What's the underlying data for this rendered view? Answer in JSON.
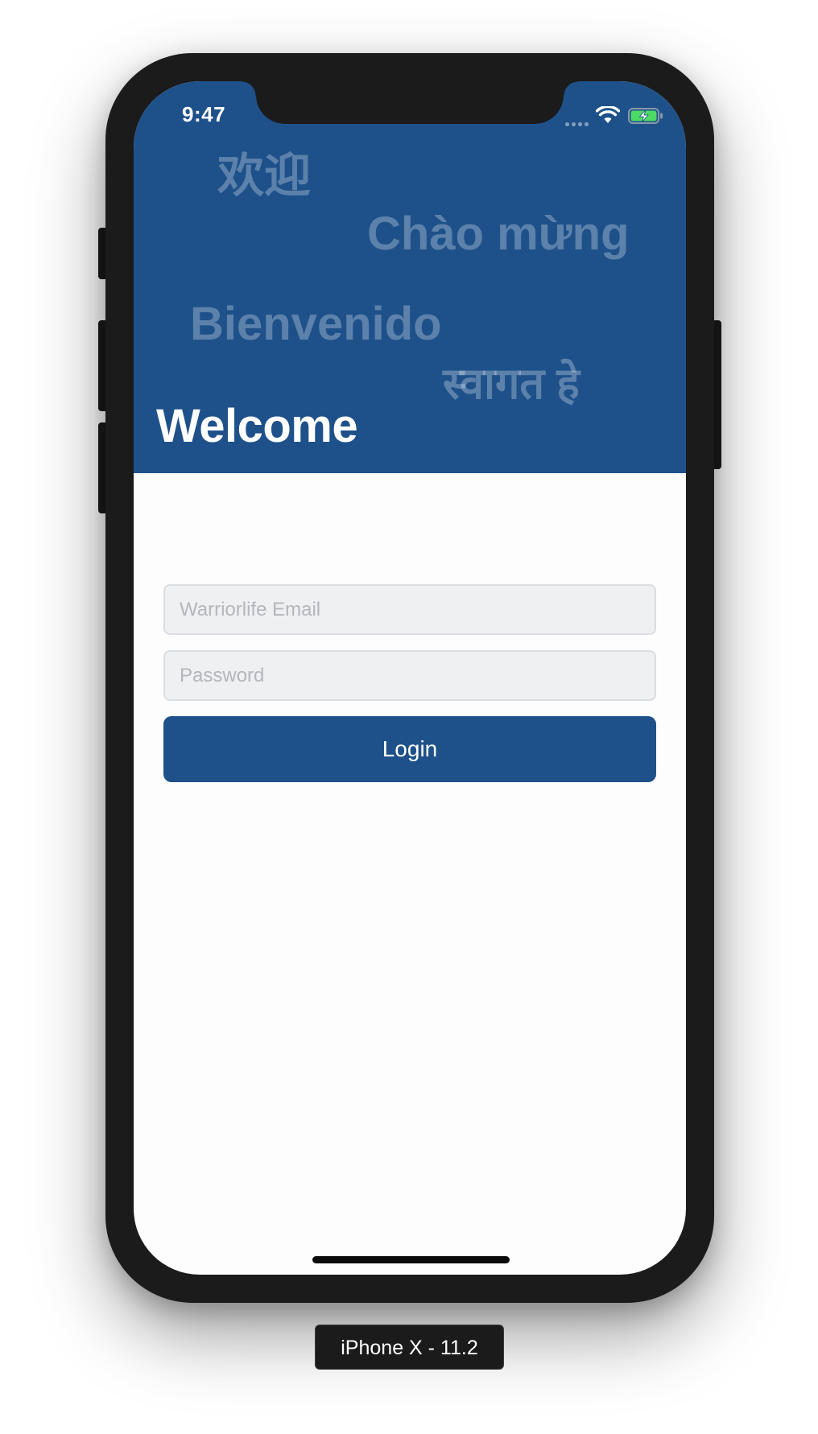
{
  "status_bar": {
    "time": "9:47"
  },
  "header": {
    "background_color": "#1e518a",
    "greetings": {
      "chinese": "欢迎",
      "vietnamese": "Chào mừng",
      "spanish": "Bienvenido",
      "hindi": "स्वागत हे"
    },
    "title": "Welcome"
  },
  "form": {
    "email_placeholder": "Warriorlife Email",
    "email_value": "",
    "password_placeholder": "Password",
    "password_value": "",
    "login_label": "Login"
  },
  "device_label": "iPhone X - 11.2",
  "icons": [
    "cellular-signal-icon",
    "wifi-icon",
    "battery-charging-icon"
  ]
}
